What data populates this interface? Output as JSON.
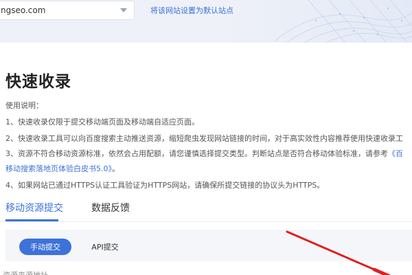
{
  "header": {
    "site_select_value": "ngseo.com",
    "set_default_link": "将该网站设置为默认站点"
  },
  "page": {
    "title": "快速收录"
  },
  "usage": {
    "heading": "使用说明：",
    "line1": "1、快速收录仅限于提交移动端页面及移动端自适应页面。",
    "line2": "2、快速收录工具可以向百度搜索主动推送资源，缩短爬虫发现网站链接的时间，对于高实效性内容推荐使用快速收录工",
    "line3_text": "3、资源不符合移动资源标准，依然会占用配额，请您谨慎选择提交类型。判断站点是否符合移动体验标准，请参考",
    "line3_link": "《百",
    "line4_link": "移动搜索落地页体验白皮书5.0》",
    "line4_suffix": "。",
    "line5": "4、如果网站已通过HTTPS认证工具验证为HTTPS网站，请确保所提交链接的协议头为HTTPS。"
  },
  "tabs": [
    {
      "label": "移动资源提交",
      "active": true
    },
    {
      "label": "数据反馈",
      "active": false
    }
  ],
  "submit_modes": [
    {
      "label": "手动提交",
      "active": true
    },
    {
      "label": "API提交",
      "active": false
    }
  ],
  "cutoff_text": "资源来源地址",
  "colors": {
    "accent": "#3d72d9",
    "arrow": "#e02020"
  }
}
